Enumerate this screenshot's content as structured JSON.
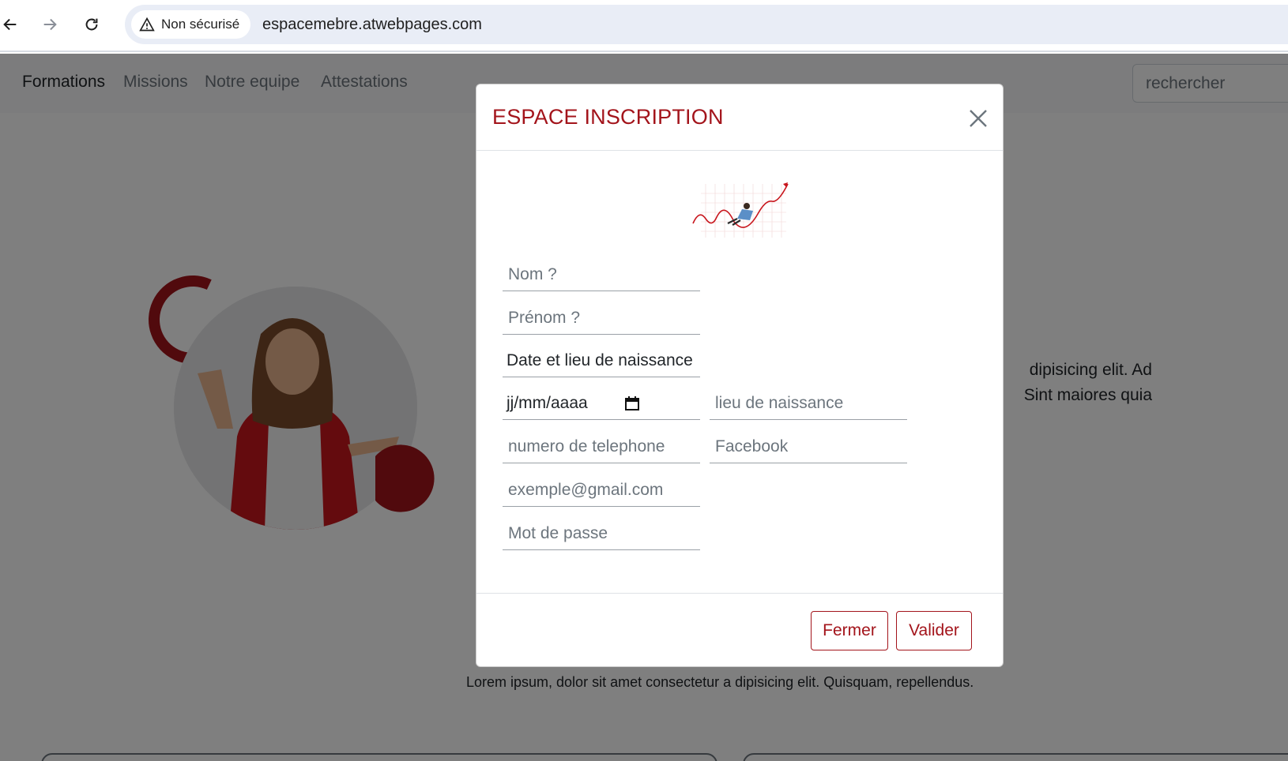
{
  "browser": {
    "security_label": "Non sécurisé",
    "url": "espacemebre.atwebpages.com"
  },
  "site_nav": {
    "links": [
      "Formations",
      "Missions",
      "Notre equipe",
      "Attestations"
    ],
    "search_placeholder": "rechercher"
  },
  "hero": {
    "text_line1": "dipisicing elit. Ad",
    "text_line2": "Sint maiores quia"
  },
  "section": {
    "lorem": "Lorem ipsum, dolor sit amet consectetur a dipisicing elit. Quisquam, repellendus."
  },
  "modal": {
    "title": "ESPACE INSCRIPTION",
    "fields": {
      "nom": "Nom ?",
      "prenom": "Prénom ?",
      "date_lieu_label": "Date et lieu de naissance",
      "date_placeholder": "jj/mm/aaaa",
      "lieu": "lieu de naissance",
      "telephone": "numero de telephone",
      "facebook": "Facebook",
      "email": "exemple@gmail.com",
      "password": "Mot de passe"
    },
    "buttons": {
      "close": "Fermer",
      "submit": "Valider"
    }
  },
  "colors": {
    "accent": "#a3141b",
    "backdrop": "rgba(0,0,0,0.5)"
  },
  "icons": [
    "back-arrow-icon",
    "forward-arrow-icon",
    "reload-icon",
    "warning-icon",
    "close-icon",
    "calendar-icon"
  ]
}
